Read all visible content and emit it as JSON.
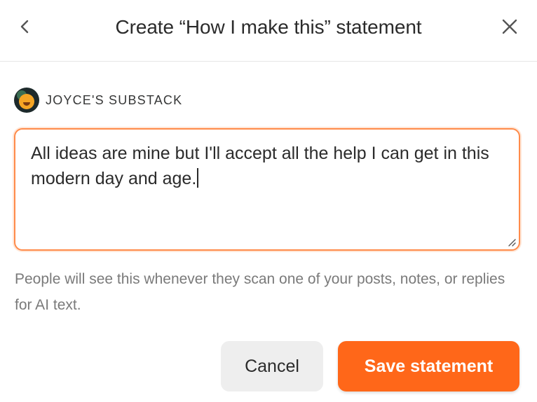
{
  "header": {
    "title": "Create “How I make this” statement",
    "back_icon": "chevron-left-icon",
    "close_icon": "close-icon"
  },
  "publication": {
    "name": "JOYCE'S SUBSTACK",
    "avatar_icon": "avatar"
  },
  "statement": {
    "value": "All ideas are mine but I'll accept all the help I can get in this modern day and age."
  },
  "help_text": "People will see this whenever they scan one of your posts, notes, or replies for AI text.",
  "actions": {
    "cancel_label": "Cancel",
    "save_label": "Save statement"
  },
  "colors": {
    "accent": "#ff6719",
    "focus_border": "#ff8b4a",
    "secondary_button": "#eeeeee",
    "muted_text": "#7a7a7a"
  }
}
